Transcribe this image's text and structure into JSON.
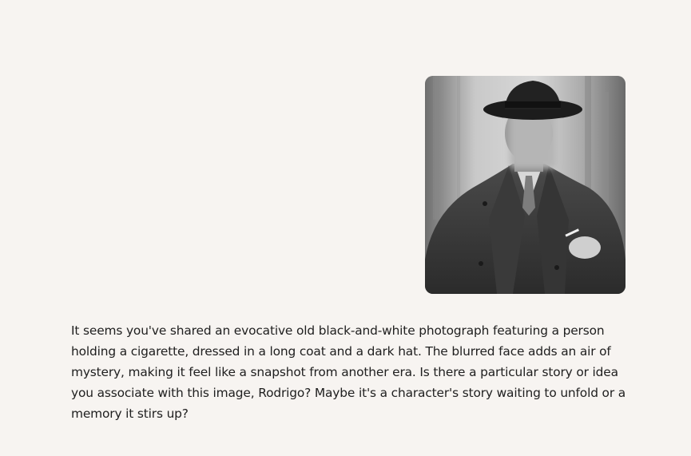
{
  "conversation": {
    "user_image": {
      "icon": "photo-attachment",
      "style": "black-and-white"
    },
    "assistant_message": "It seems you've shared an evocative old black-and-white photograph featuring a person holding a cigarette, dressed in a long coat and a dark hat. The blurred face adds an air of mystery, making it feel like a snapshot from another era. Is there a particular story or idea you associate with this image, Rodrigo? Maybe it's a character's story waiting to unfold or a memory it stirs up?"
  }
}
